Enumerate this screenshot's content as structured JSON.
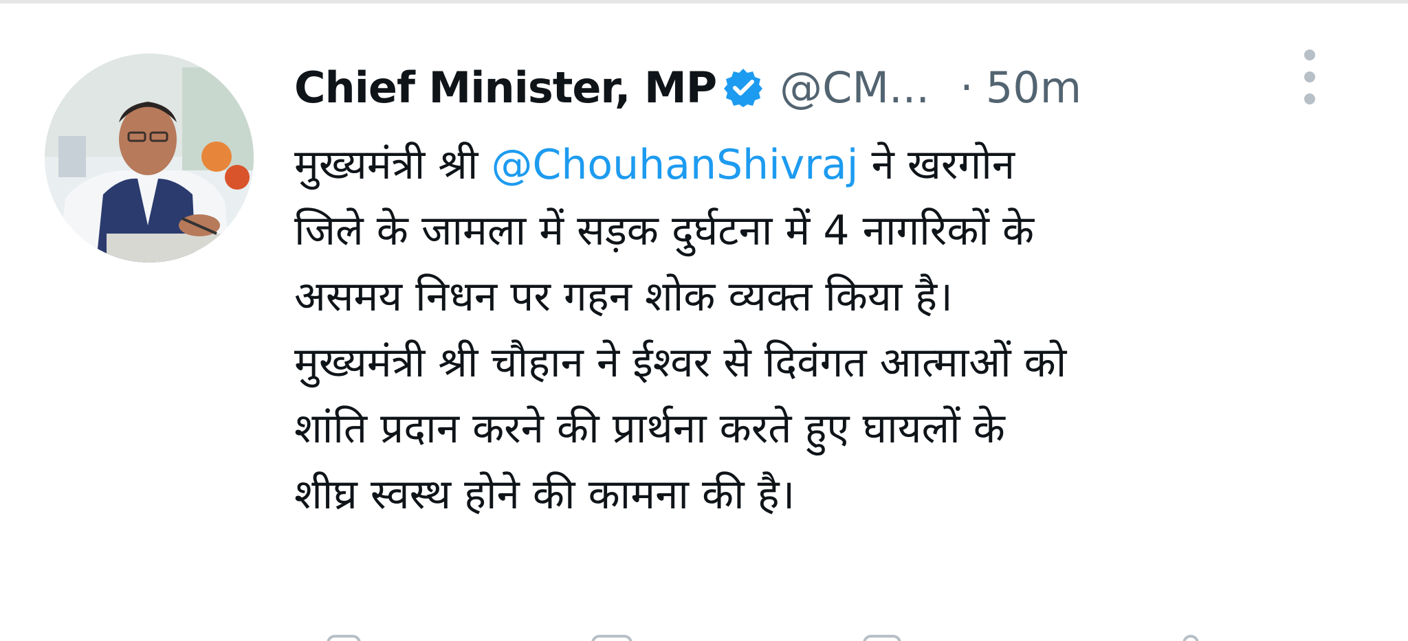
{
  "tweet": {
    "display_name": "Chief Minister, MP",
    "handle": "@CM...",
    "separator": "·",
    "time": "50m",
    "verified_icon": "verified-badge-icon",
    "more_icon": "more-options-icon",
    "body": {
      "line1_prefix": "मुख्यमंत्री श्री ",
      "mention": "@ChouhanShivraj",
      "line1_suffix": " ने खरगोन",
      "line2": "जिले के जामला में सड़क दुर्घटना में 4 नागरिकों के",
      "line3": "असमय निधन पर गहन शोक व्यक्त किया है।",
      "line4": "मुख्यमंत्री श्री चौहान ने ईश्वर से दिवंगत आत्माओं को",
      "line5": "शांति प्रदान करने की प्रार्थना करते हुए घायलों के",
      "line6": "शीघ्र स्वस्थ होने की कामना की है।"
    }
  },
  "colors": {
    "text": "#0f1419",
    "muted": "#536471",
    "link": "#1d9bf0",
    "verified": "#1d9bf0"
  }
}
